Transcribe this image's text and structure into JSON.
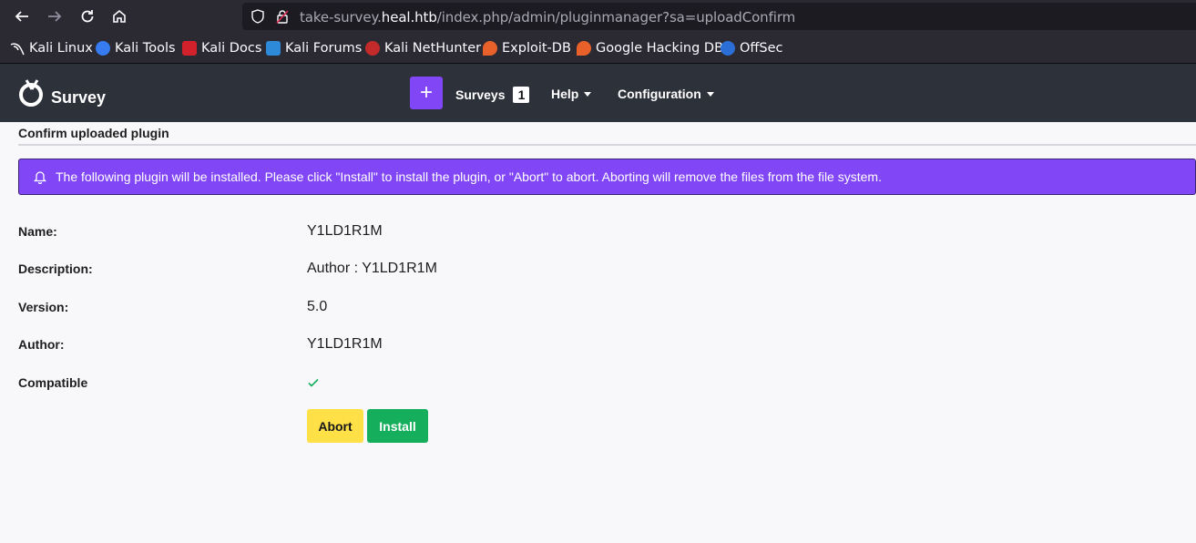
{
  "browser": {
    "url_prefix": "take-survey.",
    "url_host": "heal.htb",
    "url_path": "/index.php/admin/pluginmanager?sa=uploadConfirm",
    "bookmarks": [
      {
        "label": "Kali Linux",
        "icon": "kali-dragon-icon"
      },
      {
        "label": "Kali Tools",
        "icon": "kali-tools-icon"
      },
      {
        "label": "Kali Docs",
        "icon": "kali-docs-icon"
      },
      {
        "label": "Kali Forums",
        "icon": "kali-forums-icon"
      },
      {
        "label": "Kali NetHunter",
        "icon": "kali-nethunter-icon"
      },
      {
        "label": "Exploit-DB",
        "icon": "exploit-db-icon"
      },
      {
        "label": "Google Hacking DB",
        "icon": "google-hacking-db-icon"
      },
      {
        "label": "OffSec",
        "icon": "offsec-icon"
      }
    ]
  },
  "header": {
    "brand": "Survey",
    "menu": {
      "surveys_label": "Surveys",
      "surveys_count": "1",
      "help_label": "Help",
      "configuration_label": "Configuration"
    },
    "accent_color": "#8146f6"
  },
  "main": {
    "title": "Confirm uploaded plugin",
    "alert": "The following plugin will be installed. Please click \"Install\" to install the plugin, or \"Abort\" to abort. Aborting will remove the files from the file system.",
    "fields": {
      "name_label": "Name:",
      "name_value": "Y1LD1R1M",
      "description_label": "Description:",
      "description_value": "Author : Y1LD1R1M",
      "version_label": "Version:",
      "version_value": "5.0",
      "author_label": "Author:",
      "author_value": "Y1LD1R1M",
      "compatible_label": "Compatible",
      "compatible_icon": "check-icon"
    },
    "buttons": {
      "abort": "Abort",
      "install": "Install"
    }
  }
}
